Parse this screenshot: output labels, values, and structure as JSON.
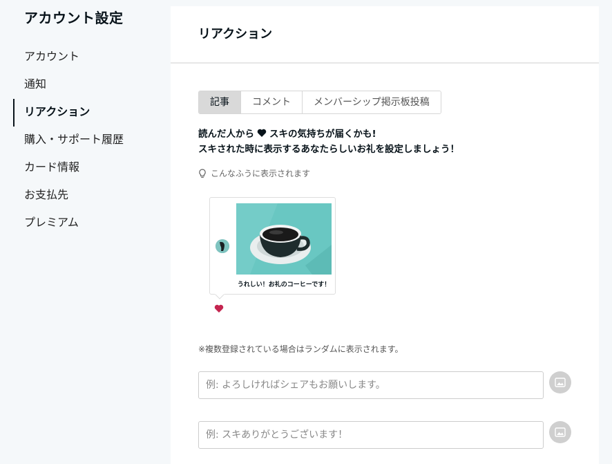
{
  "sidebar": {
    "title": "アカウント設定",
    "items": [
      {
        "label": "アカウント"
      },
      {
        "label": "通知"
      },
      {
        "label": "リアクション"
      },
      {
        "label": "購入・サポート履歴"
      },
      {
        "label": "カード情報"
      },
      {
        "label": "お支払先"
      },
      {
        "label": "プレミアム"
      }
    ],
    "active_index": 2
  },
  "main": {
    "title": "リアクション",
    "tabs": [
      {
        "label": "記事"
      },
      {
        "label": "コメント"
      },
      {
        "label": "メンバーシップ掲示板投稿"
      }
    ],
    "description": {
      "line1_before": "読んだ人から",
      "line1_after": "スキの気持ちが届くかも!",
      "line2": "スキされた時に表示するあなたらしいお礼を設定しましょう！"
    },
    "hint": "こんなふうに表示されます",
    "preview": {
      "caption": "うれしい！お礼のコーヒーです！"
    },
    "note": "※複数登録されている場合はランダムに表示されます。",
    "inputs": [
      {
        "placeholder": "例: よろしければシェアもお願いします。",
        "value": ""
      },
      {
        "placeholder": "例: スキありがとうございます！",
        "value": ""
      }
    ]
  },
  "colors": {
    "background": "#f5f8fa",
    "heart_accent": "#c4254f",
    "text": "#08131a"
  },
  "icons": {
    "hint": "lightbulb-icon",
    "image_upload": "image-icon",
    "like": "heart-icon"
  }
}
